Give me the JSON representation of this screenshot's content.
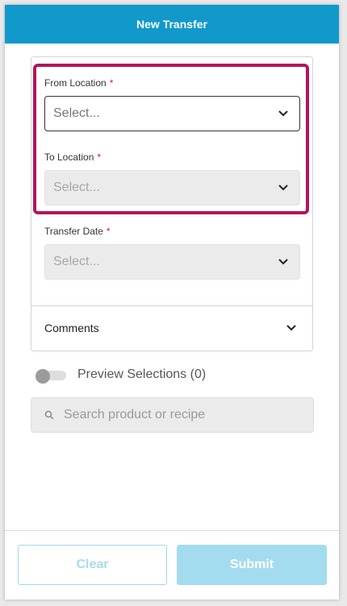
{
  "header": {
    "title": "New Transfer"
  },
  "form": {
    "from_location": {
      "label": "From Location",
      "required_mark": "*",
      "value": "Select..."
    },
    "to_location": {
      "label": "To Location",
      "required_mark": "*",
      "value": "Select..."
    },
    "transfer_date": {
      "label": "Transfer Date",
      "required_mark": "*",
      "value": "Select..."
    },
    "comments": {
      "label": "Comments"
    }
  },
  "preview": {
    "label": "Preview Selections (0)",
    "enabled": false
  },
  "search": {
    "placeholder": "Search product or recipe"
  },
  "footer": {
    "clear_label": "Clear",
    "submit_label": "Submit"
  },
  "colors": {
    "header_bg": "#1199cc",
    "highlight": "#b3145a",
    "required": "#cc1d3b",
    "submit_bg": "#a3dcef"
  },
  "icons": [
    "chevron-down-icon",
    "search-icon"
  ]
}
